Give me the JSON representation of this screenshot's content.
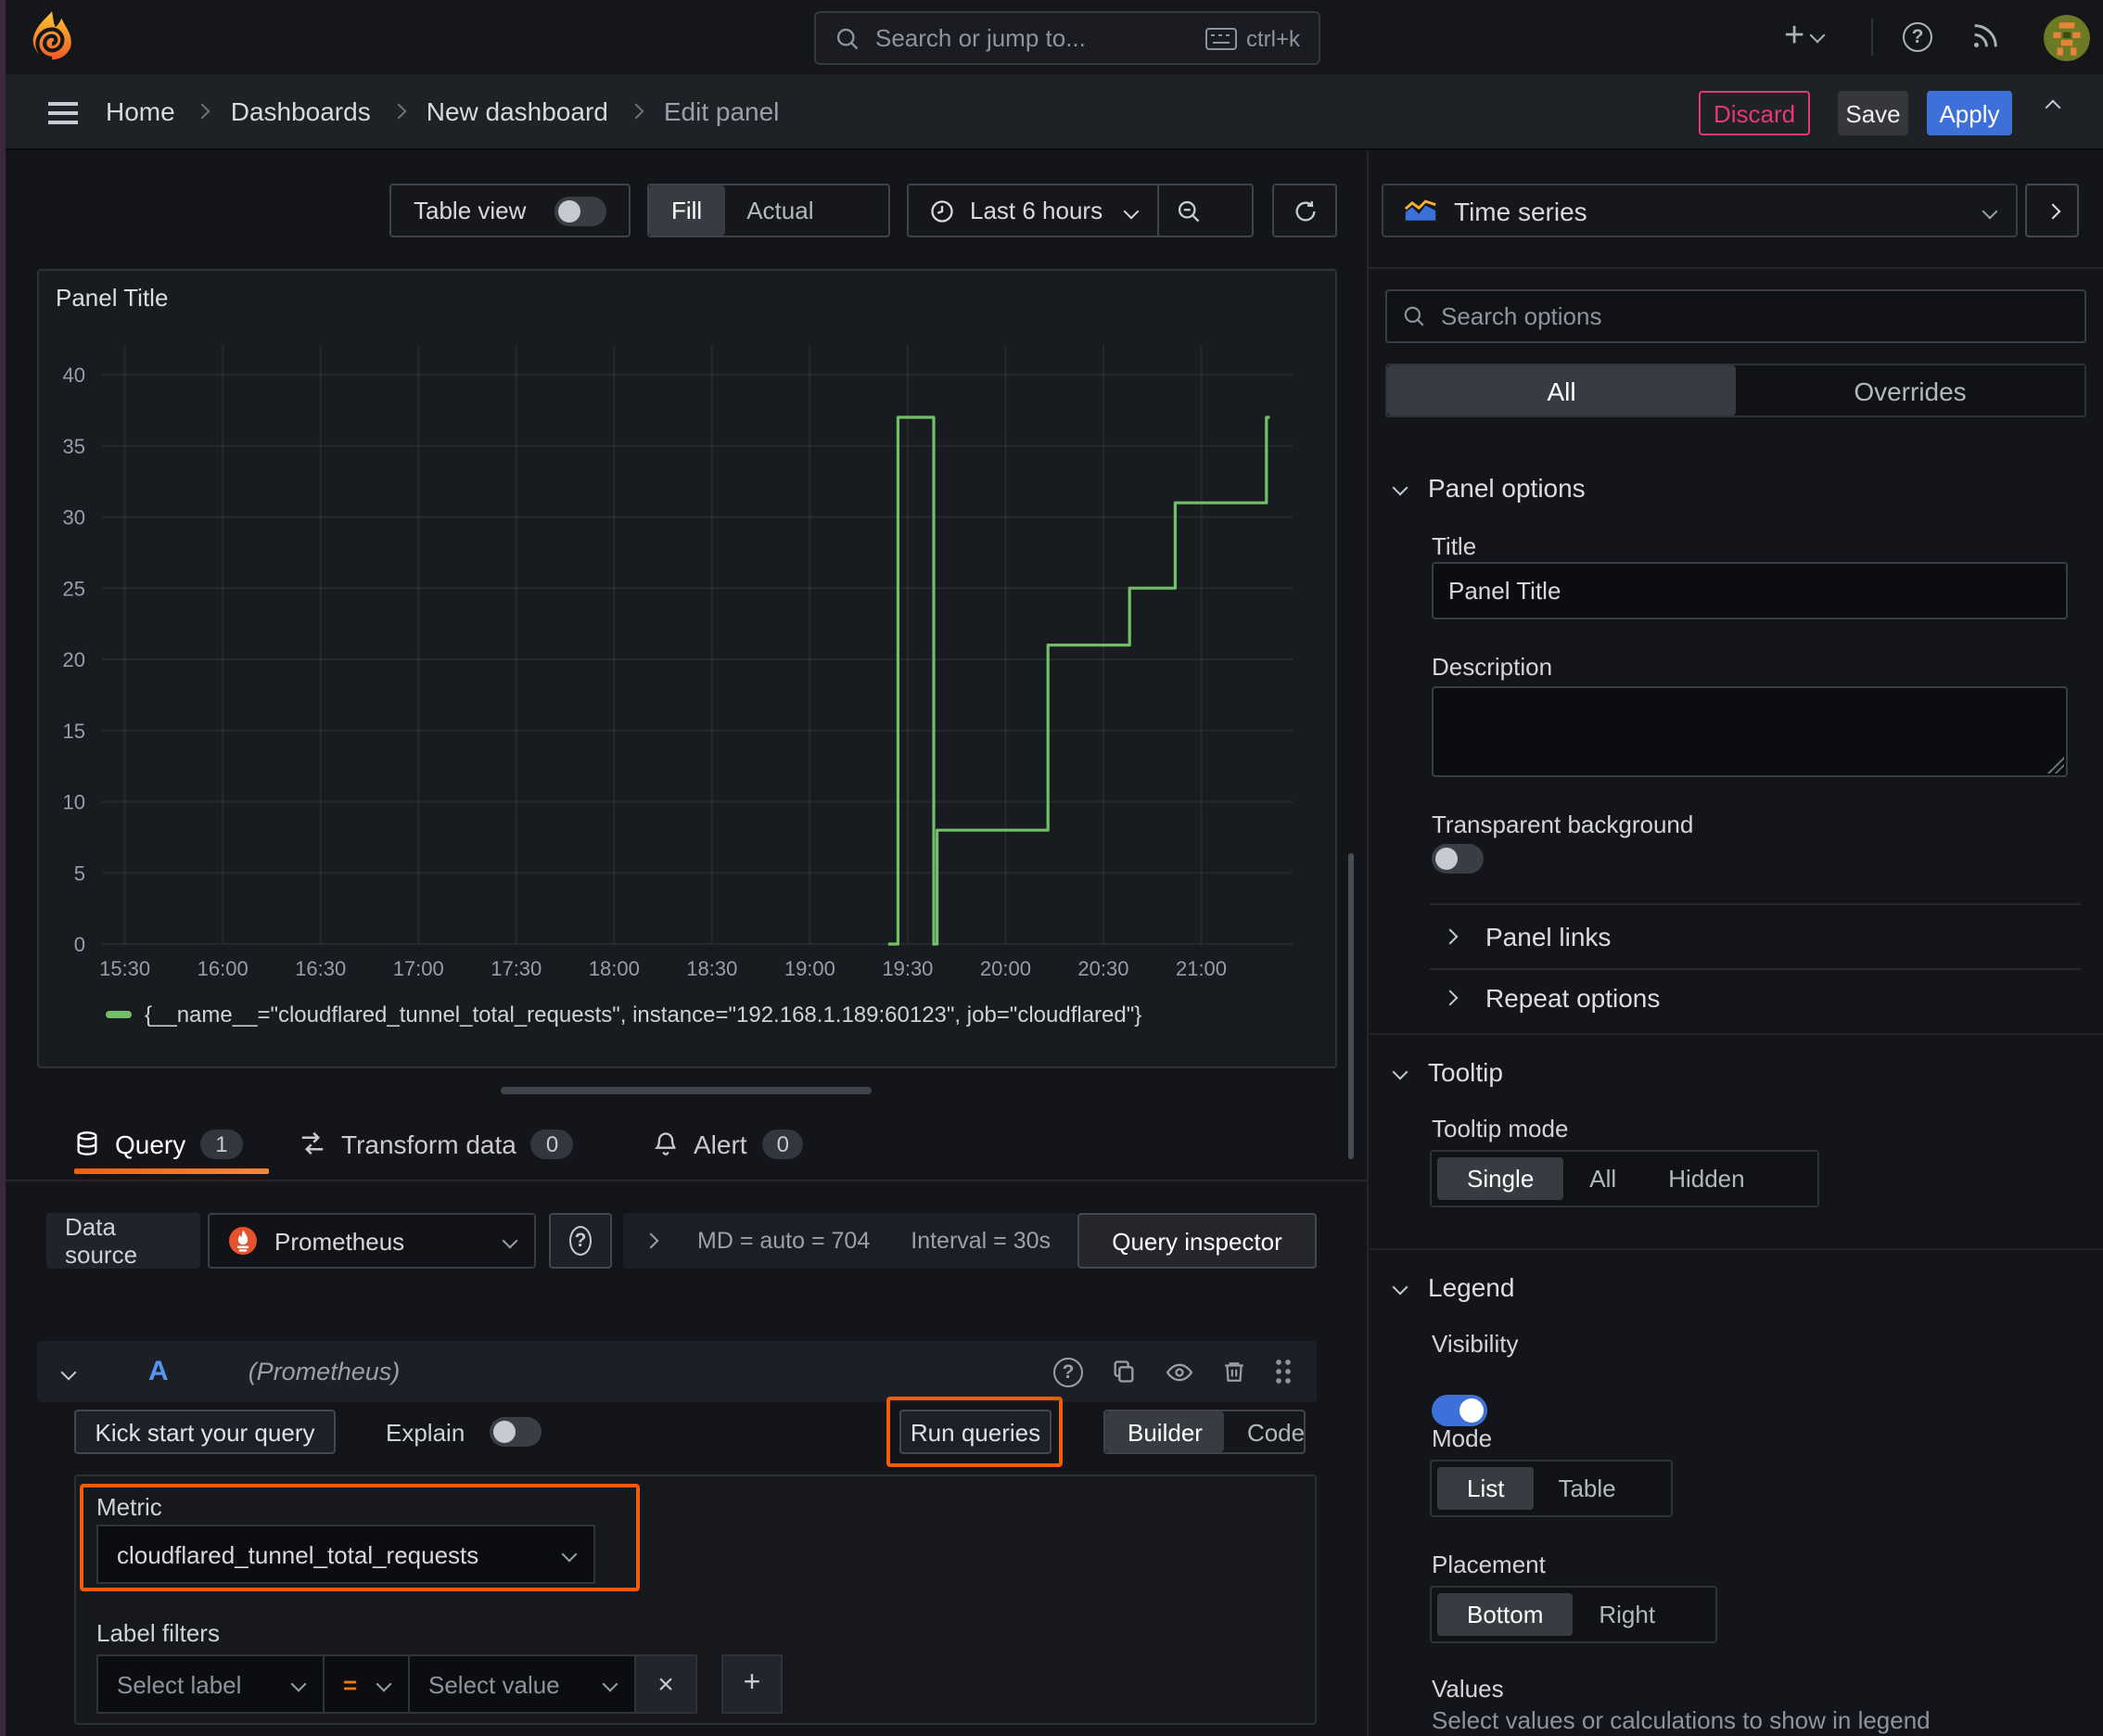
{
  "topbar": {
    "search_placeholder": "Search or jump to...",
    "search_shortcut": "ctrl+k"
  },
  "breadcrumb": {
    "items": [
      "Home",
      "Dashboards",
      "New dashboard",
      "Edit panel"
    ]
  },
  "actions": {
    "discard": "Discard",
    "save": "Save",
    "apply": "Apply"
  },
  "toolbar": {
    "table_view": "Table view",
    "fill": "Fill",
    "actual": "Actual",
    "time_range": "Last 6 hours"
  },
  "visualization_picker": {
    "label": "Time series"
  },
  "glyphs": {
    "plus": "+",
    "close": "×",
    "help": "?"
  },
  "chart_data": {
    "type": "line",
    "title": "Panel Title",
    "series": [
      {
        "name": "{__name__=\"cloudflared_tunnel_total_requests\", instance=\"192.168.1.189:60123\", job=\"cloudflared\"}",
        "color": "#73bf69",
        "points": [
          [
            "19:24",
            0
          ],
          [
            "19:27",
            0
          ],
          [
            "19:27",
            37
          ],
          [
            "19:38",
            37
          ],
          [
            "19:38",
            0
          ],
          [
            "19:39",
            0
          ],
          [
            "19:39",
            8
          ],
          [
            "20:13",
            8
          ],
          [
            "20:13",
            21
          ],
          [
            "20:38",
            21
          ],
          [
            "20:38",
            25
          ],
          [
            "20:52",
            25
          ],
          [
            "20:52",
            31
          ],
          [
            "21:20",
            31
          ],
          [
            "21:20",
            37
          ],
          [
            "21:21",
            37
          ]
        ]
      }
    ],
    "x_ticks": [
      "15:30",
      "16:00",
      "16:30",
      "17:00",
      "17:30",
      "18:00",
      "18:30",
      "19:00",
      "19:30",
      "20:00",
      "20:30",
      "21:00"
    ],
    "y_ticks": [
      0,
      5,
      10,
      15,
      20,
      25,
      30,
      35,
      40
    ],
    "ylim": [
      0,
      40
    ],
    "x_domain": [
      "15:23",
      "21:28"
    ],
    "grid": true,
    "legend_position": "bottom"
  },
  "tabs": {
    "query": {
      "label": "Query",
      "count": "1"
    },
    "transform": {
      "label": "Transform data",
      "count": "0"
    },
    "alert": {
      "label": "Alert",
      "count": "0"
    }
  },
  "datasource_row": {
    "label": "Data source",
    "value": "Prometheus",
    "options_summary": "MD = auto = 704",
    "interval": "Interval = 30s",
    "query_inspector": "Query inspector"
  },
  "query_editor": {
    "ref_id": "A",
    "datasource_hint": "(Prometheus)",
    "kick_start": "Kick start your query",
    "explain": "Explain",
    "run_queries": "Run queries",
    "builder": "Builder",
    "code": "Code",
    "metric": {
      "label": "Metric",
      "value": "cloudflared_tunnel_total_requests"
    },
    "label_filters": {
      "label": "Label filters",
      "select_label": "Select label",
      "operator": "=",
      "select_value": "Select value"
    }
  },
  "sidebar": {
    "search_placeholder": "Search options",
    "tab_all": "All",
    "tab_overrides": "Overrides",
    "panel_options": {
      "header": "Panel options",
      "title_label": "Title",
      "title_value": "Panel Title",
      "description_label": "Description",
      "transparent_label": "Transparent background"
    },
    "collapsed": {
      "panel_links": "Panel links",
      "repeat_options": "Repeat options"
    },
    "tooltip": {
      "header": "Tooltip",
      "mode_label": "Tooltip mode",
      "modes": [
        "Single",
        "All",
        "Hidden"
      ],
      "selected": "Single"
    },
    "legend": {
      "header": "Legend",
      "visibility_label": "Visibility",
      "mode_label": "Mode",
      "modes": [
        "List",
        "Table"
      ],
      "selected_mode": "List",
      "placement_label": "Placement",
      "placements": [
        "Bottom",
        "Right"
      ],
      "selected_placement": "Bottom",
      "values_label": "Values",
      "values_hint": "Select values or calculations to show in legend"
    }
  },
  "colors": {
    "accent_orange": "#f25c0c",
    "green": "#73bf69",
    "blue": "#3d71d9",
    "pink": "#e5396f"
  }
}
